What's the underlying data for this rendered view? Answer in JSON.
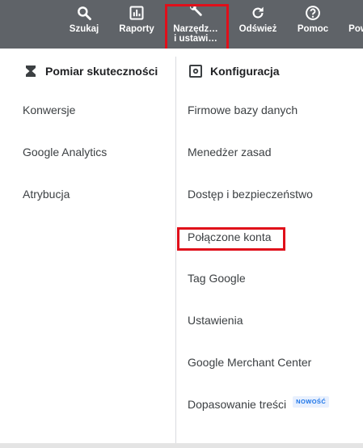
{
  "toolbar": {
    "search_label": "Szukaj",
    "reports_label": "Raporty",
    "tools_label_line1": "Narzędz…",
    "tools_label_line2": "i ustawi…",
    "refresh_label": "Odśwież",
    "help_label": "Pomoc",
    "more_label": "Pow"
  },
  "menu": {
    "left": {
      "heading": "Pomiar skuteczności",
      "items": [
        "Konwersje",
        "Google Analytics",
        "Atrybucja"
      ]
    },
    "right": {
      "heading": "Konfiguracja",
      "items": [
        "Firmowe bazy danych",
        "Menedżer zasad",
        "Dostęp i bezpieczeństwo",
        "Połączone konta",
        "Tag Google",
        "Ustawienia",
        "Google Merchant Center",
        "Dopasowanie treści"
      ],
      "new_badge": "NOWOŚĆ"
    }
  },
  "colors": {
    "toolbar_bg": "#5f6368",
    "highlight": "#e00f1a",
    "badge_text": "#1a73e8",
    "badge_bg": "#e8f0fe"
  }
}
